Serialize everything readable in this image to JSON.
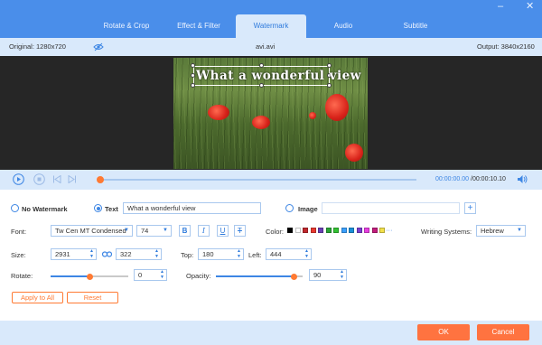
{
  "tabs": [
    {
      "label": "Rotate & Crop"
    },
    {
      "label": "Effect & Filter"
    },
    {
      "label": "Watermark"
    },
    {
      "label": "Audio"
    },
    {
      "label": "Subtitle"
    }
  ],
  "active_tab": "Watermark",
  "window_controls": {
    "minimize": "–",
    "close": "✕"
  },
  "infobar": {
    "original": "Original: 1280x720",
    "filename": "avi.avi",
    "output": "Output: 3840x2160"
  },
  "preview": {
    "watermark_text": "What a wonderful view"
  },
  "playback": {
    "progress": 0.0,
    "current_time": "00:00:00.00",
    "total_time": "/00:00:10.10",
    "volume_icon": "speaker-icon"
  },
  "watermark": {
    "none_label": "No Watermark",
    "text_label": "Text",
    "text_value": "What a wonderful view",
    "image_label": "Image",
    "image_value": "",
    "selected": "Text"
  },
  "font": {
    "label": "Font:",
    "family": "Tw Cen MT Condensed",
    "size": "74",
    "bold": "B",
    "italic": "I",
    "underline": "U",
    "strike": "T"
  },
  "color": {
    "label": "Color:",
    "swatches": [
      "#000000",
      "#ffffff",
      "#c0272d",
      "#e8392f",
      "#6a3fb5",
      "#2aa336",
      "#33c233",
      "#3aa0ff",
      "#1a8fd8",
      "#7a3fd0",
      "#e83fe0",
      "#c21c7c",
      "#f2e04a"
    ],
    "more": "···"
  },
  "writing": {
    "label": "Writing Systems:",
    "value": "Hebrew"
  },
  "size": {
    "label": "Size:",
    "width": "2931",
    "height": "322"
  },
  "position": {
    "top_label": "Top:",
    "top": "180",
    "left_label": "Left:",
    "left": "444"
  },
  "rotate": {
    "label": "Rotate:",
    "value": "0",
    "level": 0.5
  },
  "opacity": {
    "label": "Opacity:",
    "value": "90",
    "level": 0.9
  },
  "actions": {
    "apply_all": "Apply to All",
    "reset": "Reset"
  },
  "footer": {
    "ok": "OK",
    "cancel": "Cancel"
  },
  "colors": {
    "accent": "#3d86e4",
    "header": "#4a8eea",
    "orange": "#ff7340"
  }
}
